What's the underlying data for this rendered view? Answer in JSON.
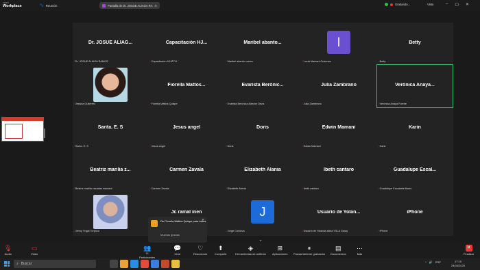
{
  "app": {
    "brand_top": "zoom",
    "brand_bottom": "Workplace",
    "meeting_label": "Reunión"
  },
  "share": {
    "label": "Pantalla de Dr. JOSUE ALIAGA RA"
  },
  "status": {
    "recording": "Grabando...",
    "view": "Vista"
  },
  "tiles": [
    {
      "name": "Dr. JOSUE ALIAG...",
      "label": "Dr. JOSUE ALIAGA RAMOS"
    },
    {
      "name": "Capacitación HJ...",
      "label": "Capacitación HJATCH"
    },
    {
      "name": "Maribel abanto...",
      "label": "Maribel abanto correa"
    },
    {
      "avatar": "l",
      "avatar_color": "#6a4fd0",
      "label": "Lucia Mamani Gutierrez"
    },
    {
      "name": "Betty",
      "label": "Betty"
    },
    {
      "photo": "woman-portrait",
      "label": "Jessica Gutierrez"
    },
    {
      "name": "Fiorella Mattos...",
      "label": "Fiorella Mattos Quispe"
    },
    {
      "name": "Evarista Berónic...",
      "label": "Evarista Berónica Alarcón Deza"
    },
    {
      "name": "Julia Zambrano",
      "label": "Julia Zambrano"
    },
    {
      "name": "Verónica Anaya...",
      "label": "Verónica Anaya Fuente",
      "active": true
    },
    {
      "name": "Sarita. E. S",
      "label": "Sarita. E. S"
    },
    {
      "name": "Jesus angel",
      "label": "Jesus angel"
    },
    {
      "name": "Doris",
      "label": "Doris"
    },
    {
      "name": "Edwin Mamani",
      "label": "Edwin Mamani"
    },
    {
      "name": "Karin",
      "label": "Karin"
    },
    {
      "name": "Beatriz marilia z...",
      "label": "Beatriz marilia zacarias mamani"
    },
    {
      "name": "Carmen Zavala",
      "label": "Carmen Zavala"
    },
    {
      "name": "Elizabeth Alania",
      "label": "Elizabeth Alania"
    },
    {
      "name": "Ibeth cantaro",
      "label": "Ibeth cantaro"
    },
    {
      "name": "Guadalupe Escal...",
      "label": "Guadalupe Escalante flores"
    },
    {
      "photo": "nurse-portrait",
      "label": "Jenny Yngai Torpoco"
    },
    {
      "name": "Jc ramal inen",
      "label": ""
    },
    {
      "avatar": "J",
      "avatar_color": "#1c6bd8",
      "label": "Jorge Cordova"
    },
    {
      "name": "Usuario de Yolan...",
      "label": "Usuario de Yolanda  alicia YSLA Garay"
    },
    {
      "name": "iPhone",
      "label": "iPhone"
    }
  ],
  "chat_popup": {
    "from": "De Fiorella Mattos Quispe para todos",
    "message": "Muchas gracias"
  },
  "toolbar": [
    {
      "icon": "mic-muted-icon",
      "glyph": "🎙",
      "label": "Audio",
      "red": true
    },
    {
      "icon": "video-off-icon",
      "glyph": "▭",
      "label": "Video",
      "red": true
    },
    {
      "icon": "participants-icon",
      "glyph": "👥",
      "label": "Participantes",
      "count": "59"
    },
    {
      "icon": "chat-icon",
      "glyph": "💬",
      "label": "Chat"
    },
    {
      "icon": "reactions-icon",
      "glyph": "♡",
      "label": "Reaccionar"
    },
    {
      "icon": "share-icon",
      "glyph": "⬆",
      "label": "Compartir"
    },
    {
      "icon": "host-tools-icon",
      "glyph": "◈",
      "label": "Herramientas de anfitrión"
    },
    {
      "icon": "apps-icon",
      "glyph": "⊞",
      "label": "Aplicaciones"
    },
    {
      "icon": "pause-recording-icon",
      "glyph": "⏸",
      "label": "Pausar/detener grabación"
    },
    {
      "icon": "documents-icon",
      "glyph": "▤",
      "label": "Documentos"
    },
    {
      "icon": "more-icon",
      "glyph": "⋯",
      "label": "Más"
    },
    {
      "icon": "end-icon",
      "glyph": "✕",
      "label": "Finalizar",
      "end": true
    }
  ],
  "taskbar": {
    "search_placeholder": "Buscar",
    "lang": "ESP",
    "time": "17:15",
    "date": "24/04/2025"
  }
}
